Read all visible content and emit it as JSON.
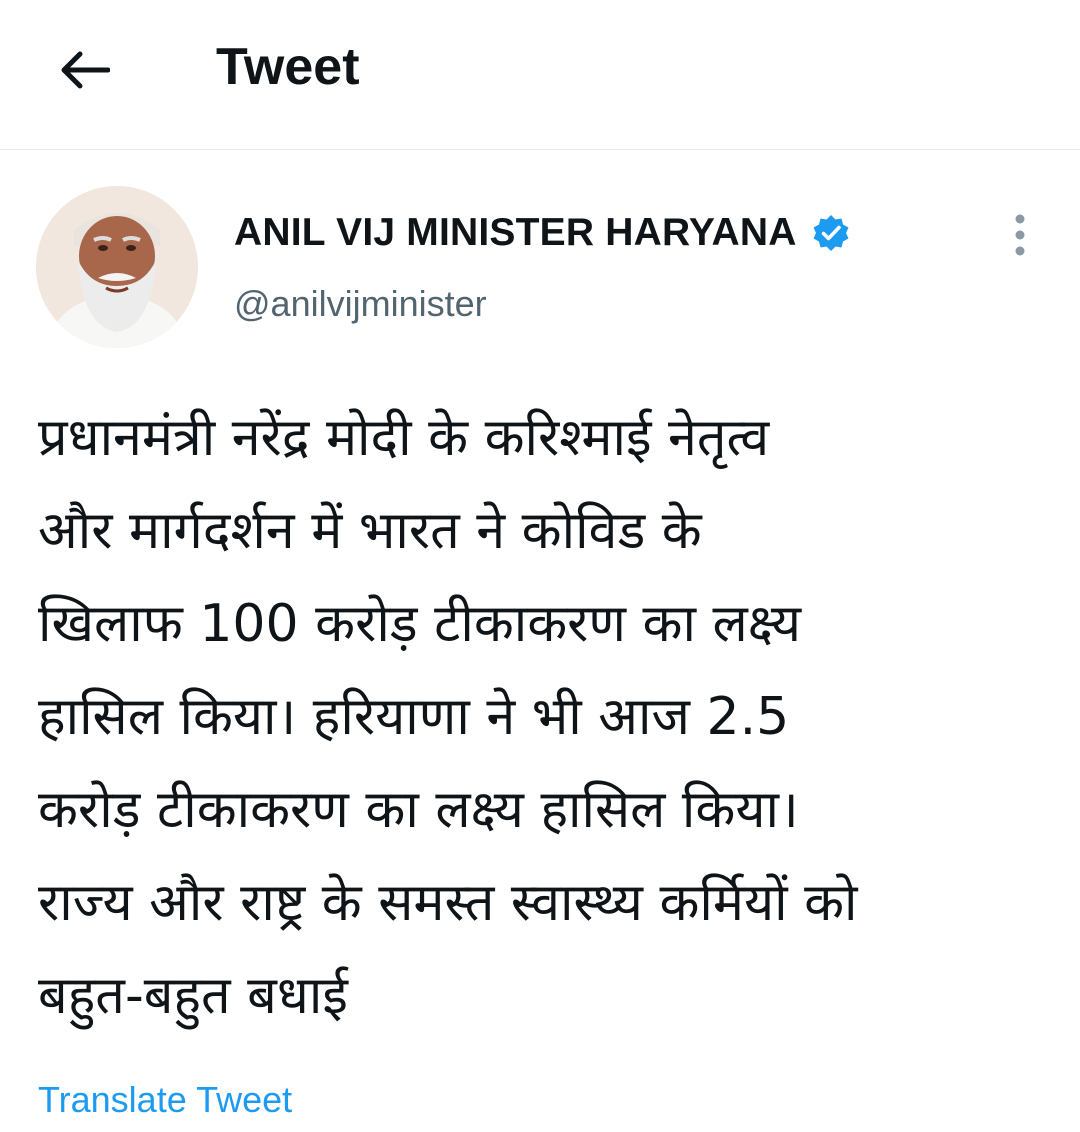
{
  "header": {
    "title": "Tweet",
    "back_icon": "arrow-left-icon"
  },
  "tweet": {
    "author": {
      "display_name": "ANIL VIJ MINISTER HARYANA",
      "handle": "@anilvijminister",
      "verified": true,
      "verified_icon": "verified-badge-icon",
      "avatar": "profile-photo"
    },
    "more_icon": "more-vertical-icon",
    "text": "प्रधानमंत्री नरेंद्र मोदी के करिश्माई नेतृत्व\nऔर मार्गदर्शन में भारत ने कोविड के\nखिलाफ 100 करोड़ टीकाकरण का लक्ष्य\nहासिल किया।  हरियाणा ने भी आज 2.5\nकरोड़ टीकाकरण का लक्ष्य हासिल किया।\nराज्य और राष्ट्र के समस्त स्वास्थ्य कर्मियों को\nबहुत-बहुत बधाई",
    "translate_label": "Translate Tweet"
  },
  "colors": {
    "text": "#0f1419",
    "secondary": "#536471",
    "accent": "#1d9bf0",
    "divider": "#e6ecf0"
  }
}
